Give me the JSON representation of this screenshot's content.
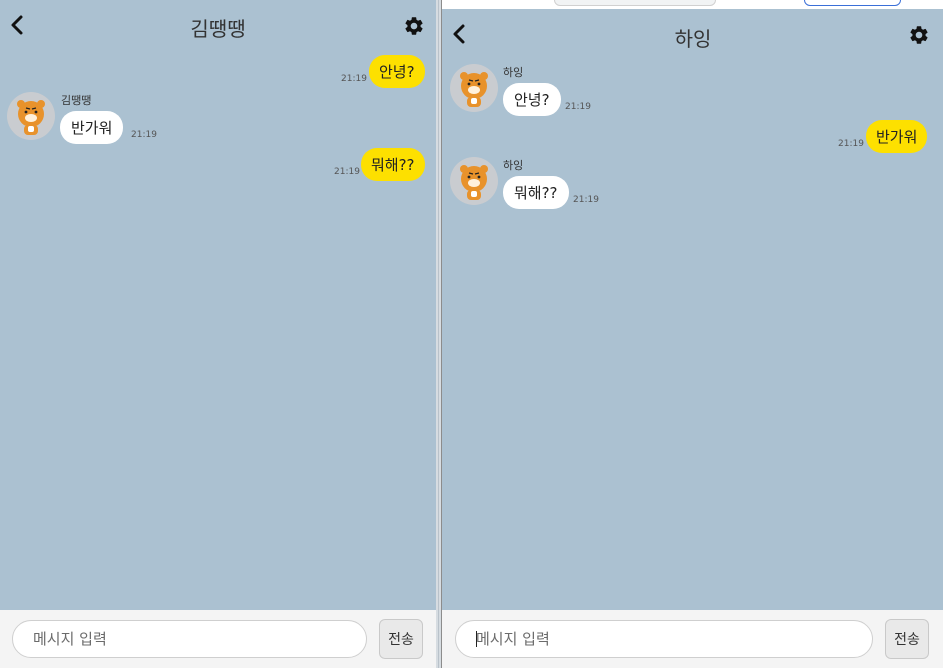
{
  "left_chat": {
    "title": "김땡땡",
    "messages": [
      {
        "from": "me",
        "text": "안녕?",
        "time": "21:19"
      },
      {
        "from": "other",
        "sender": "김땡땡",
        "text": "반가워",
        "time": "21:19"
      },
      {
        "from": "me",
        "text": "뭐해??",
        "time": "21:19"
      }
    ],
    "input_placeholder": "메시지 입력",
    "send_label": "전송"
  },
  "right_chat": {
    "title": "하잉",
    "messages": [
      {
        "from": "other",
        "sender": "하잉",
        "text": "안녕?",
        "time": "21:19"
      },
      {
        "from": "me",
        "text": "반가워",
        "time": "21:19"
      },
      {
        "from": "other",
        "sender": "하잉",
        "text": "뭐해??",
        "time": "21:19"
      }
    ],
    "input_placeholder": "메시지 입력",
    "send_label": "전송"
  },
  "icons": {
    "back": "chevron-left-icon",
    "settings": "gear-icon",
    "avatar": "lion-character-avatar"
  },
  "colors": {
    "chat_background": "#abc1d1",
    "my_bubble": "#fde000",
    "other_bubble": "#ffffff"
  }
}
